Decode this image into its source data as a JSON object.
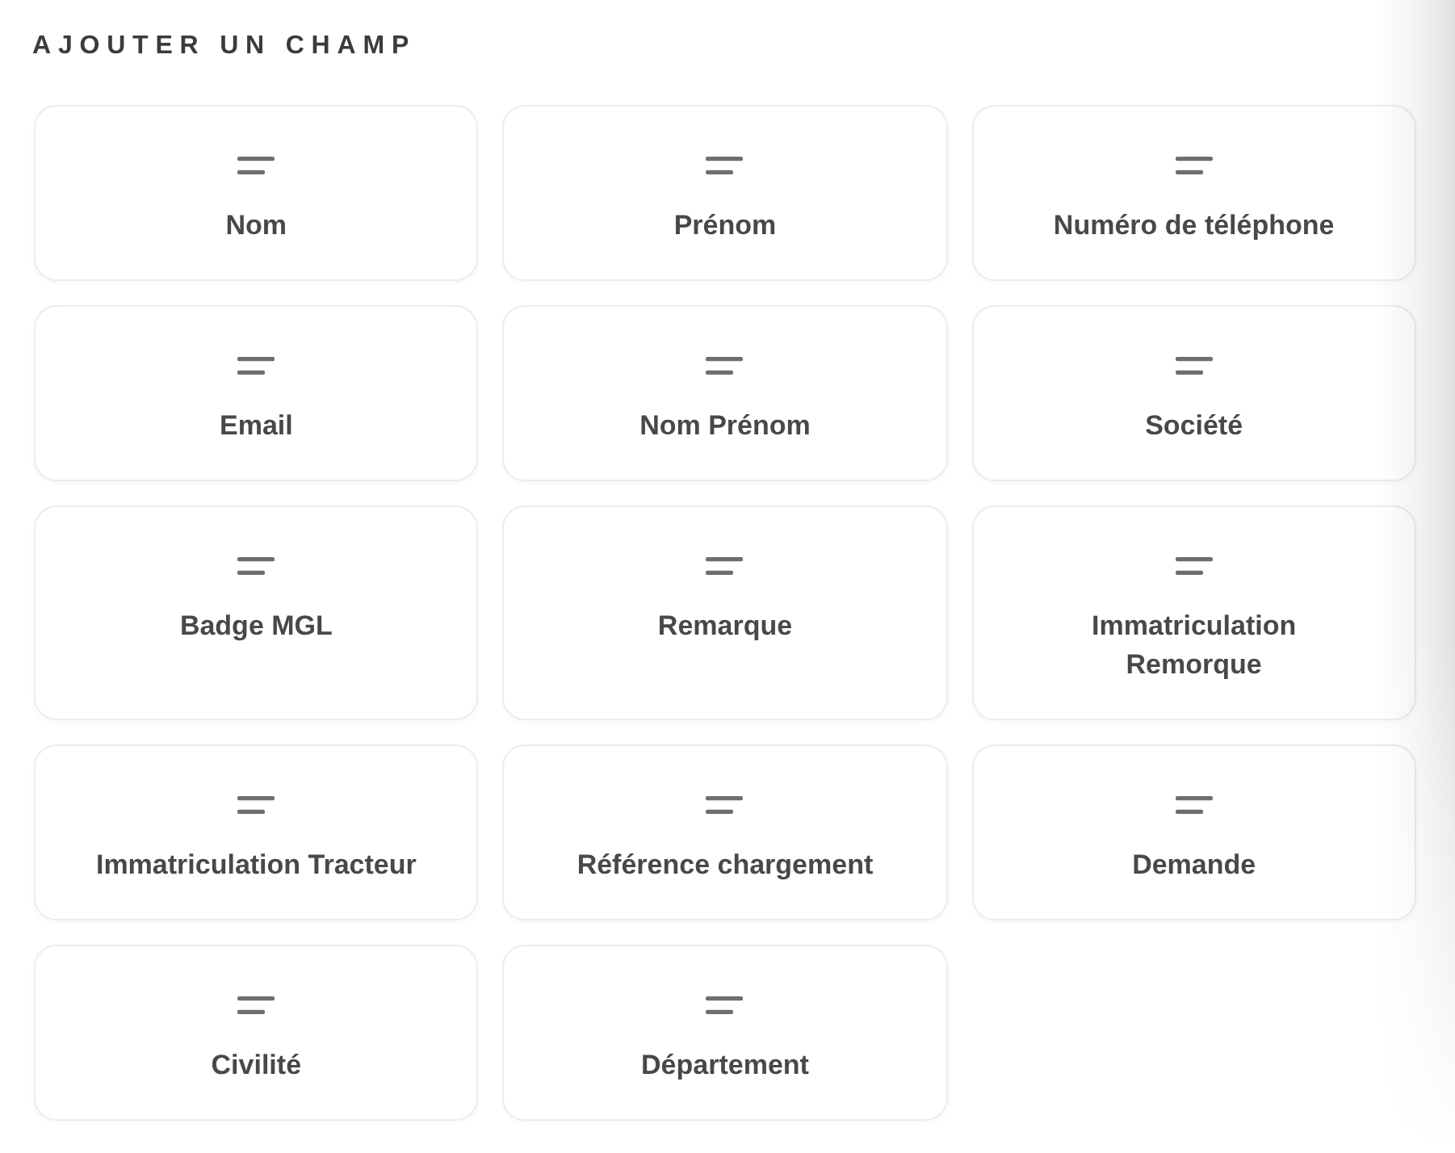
{
  "section": {
    "title": "AJOUTER UN CHAMP"
  },
  "fields": [
    {
      "label": "Nom"
    },
    {
      "label": "Prénom"
    },
    {
      "label": "Numéro de téléphone"
    },
    {
      "label": "Email"
    },
    {
      "label": "Nom Prénom"
    },
    {
      "label": "Société"
    },
    {
      "label": "Badge MGL"
    },
    {
      "label": "Remarque"
    },
    {
      "label": "Immatriculation Remorque"
    },
    {
      "label": "Immatriculation Tracteur"
    },
    {
      "label": "Référence chargement"
    },
    {
      "label": "Demande"
    },
    {
      "label": "Civilité"
    },
    {
      "label": "Département"
    }
  ]
}
